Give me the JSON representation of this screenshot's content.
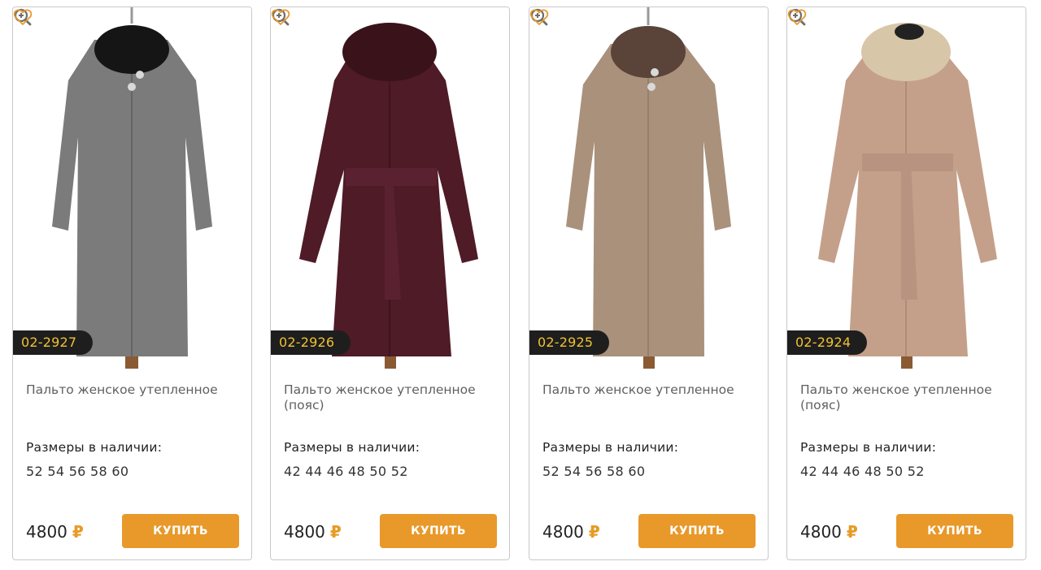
{
  "colors": {
    "accent": "#e8992a",
    "badge_bg": "#1e1e1e",
    "badge_text": "#f1c232",
    "icon": "#e8992a",
    "zoom_icon": "#6e6e6e"
  },
  "products": [
    {
      "article": "02-2927",
      "title": "Пальто женское утепленное",
      "sizes_label": "Размеры в наличии:",
      "sizes": "52 54 56 58 60",
      "price": "4800",
      "currency": "₽",
      "buy_label": "КУПИТЬ",
      "coat_color": "#7b7b7b",
      "collar_color": "#151515",
      "icons": [
        "zoom-in-icon",
        "heart-icon"
      ]
    },
    {
      "article": "02-2926",
      "title": "Пальто женское утепленное (пояс)",
      "sizes_label": "Размеры в наличии:",
      "sizes": "42 44 46 48 50 52",
      "price": "4800",
      "currency": "₽",
      "buy_label": "КУПИТЬ",
      "coat_color": "#4e1b27",
      "collar_color": "#3a121a",
      "icons": [
        "zoom-in-icon",
        "heart-icon"
      ]
    },
    {
      "article": "02-2925",
      "title": "Пальто женское утепленное",
      "sizes_label": "Размеры в наличии:",
      "sizes": "52 54 56 58 60",
      "price": "4800",
      "currency": "₽",
      "buy_label": "КУПИТЬ",
      "coat_color": "#a9917c",
      "collar_color": "#5a4338",
      "icons": [
        "zoom-in-icon",
        "heart-icon"
      ]
    },
    {
      "article": "02-2924",
      "title": "Пальто женское утепленное (пояс)",
      "sizes_label": "Размеры в наличии:",
      "sizes": "42 44 46 48 50 52",
      "price": "4800",
      "currency": "₽",
      "buy_label": "КУПИТЬ",
      "coat_color": "#c4a08a",
      "collar_color": "#d8c6a8",
      "icons": [
        "zoom-in-icon",
        "heart-icon"
      ]
    }
  ]
}
